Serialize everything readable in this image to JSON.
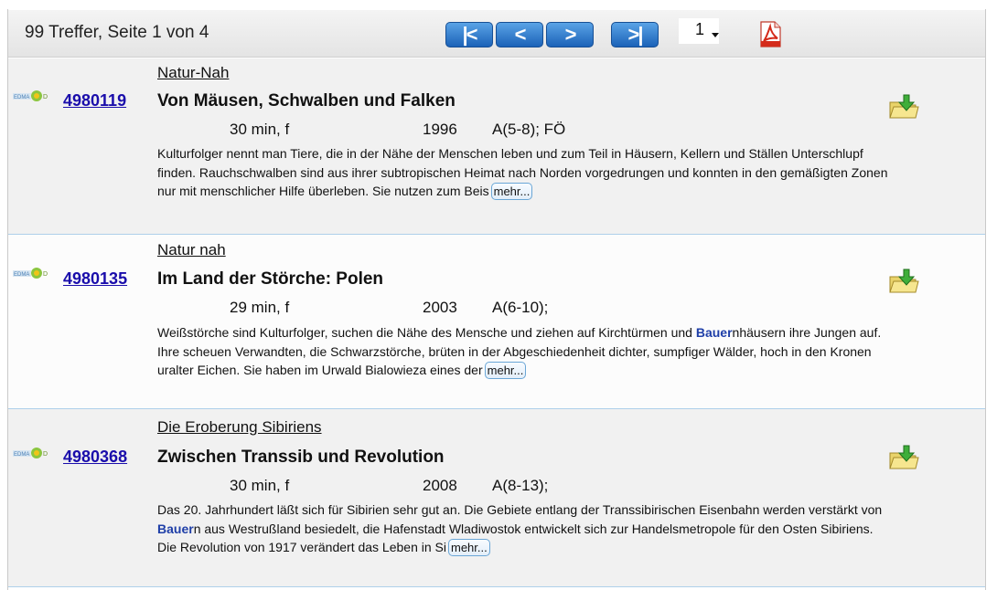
{
  "header": {
    "hits_text": "99 Treffer, Seite 1 von 4",
    "nav": {
      "first": "|<",
      "prev": "<",
      "next": ">",
      "last": ">|"
    },
    "page_select": "1"
  },
  "results": [
    {
      "id": "4980119",
      "series": "Natur-Nah",
      "title": "Von Mäusen, Schwalben und Falken",
      "duration": "30 min, f",
      "year": "1996",
      "grade": "A(5-8); FÖ",
      "desc_before": "Kulturfolger nennt man Tiere, die in der Nähe der Menschen leben und zum Teil in Häusern, Kellern und Ställen Unterschlupf finden. Rauchschwalben sind aus ihrer subtropischen Heimat nach Norden vorgedrungen und konnten in den gemäßigten Zonen nur mit menschlicher Hilfe überleben. Sie nutzen zum Beis",
      "desc_highlight": "",
      "desc_after": "",
      "more": "mehr..."
    },
    {
      "id": "4980135",
      "series": "Natur nah",
      "title": "Im Land der Störche: Polen",
      "duration": "29 min, f",
      "year": "2003",
      "grade": "A(6-10);",
      "desc_before": "Weißstörche sind Kulturfolger, suchen die Nähe des Mensche und ziehen auf Kirchtürmen und ",
      "desc_highlight": "Bauer",
      "desc_after": "nhäusern ihre Jungen auf. Ihre scheuen Verwandten, die Schwarzstörche, brüten in der Abgeschiedenheit dichter, sumpfiger Wälder, hoch in den Kronen uralter Eichen. Sie haben im Urwald Bialowieza eines der",
      "more": "mehr..."
    },
    {
      "id": "4980368",
      "series": "Die Eroberung Sibiriens",
      "title": "Zwischen Transsib und Revolution",
      "duration": "30 min, f",
      "year": "2008",
      "grade": "A(8-13);",
      "desc_before": "Das 20. Jahrhundert läßt sich für Sibirien sehr gut an. Die Gebiete entlang der Transsibirischen Eisenbahn werden verstärkt von ",
      "desc_highlight": "Bauer",
      "desc_after": "n aus Westrußland besiedelt, die Hafenstadt Wladiwostok entwickelt sich zur Handelsmetropole für den Osten Sibiriens. Die Revolution von 1917 verändert das Leben in Si",
      "more": "mehr..."
    }
  ],
  "colors": {
    "link": "#1a0dab",
    "highlight": "#1f3fa8",
    "nav_button": "#2d7fd1",
    "separator": "#aed0ea"
  },
  "icons": {
    "edmond": "edmond-logo-icon",
    "download": "download-folder-icon",
    "pdf": "pdf-icon"
  }
}
